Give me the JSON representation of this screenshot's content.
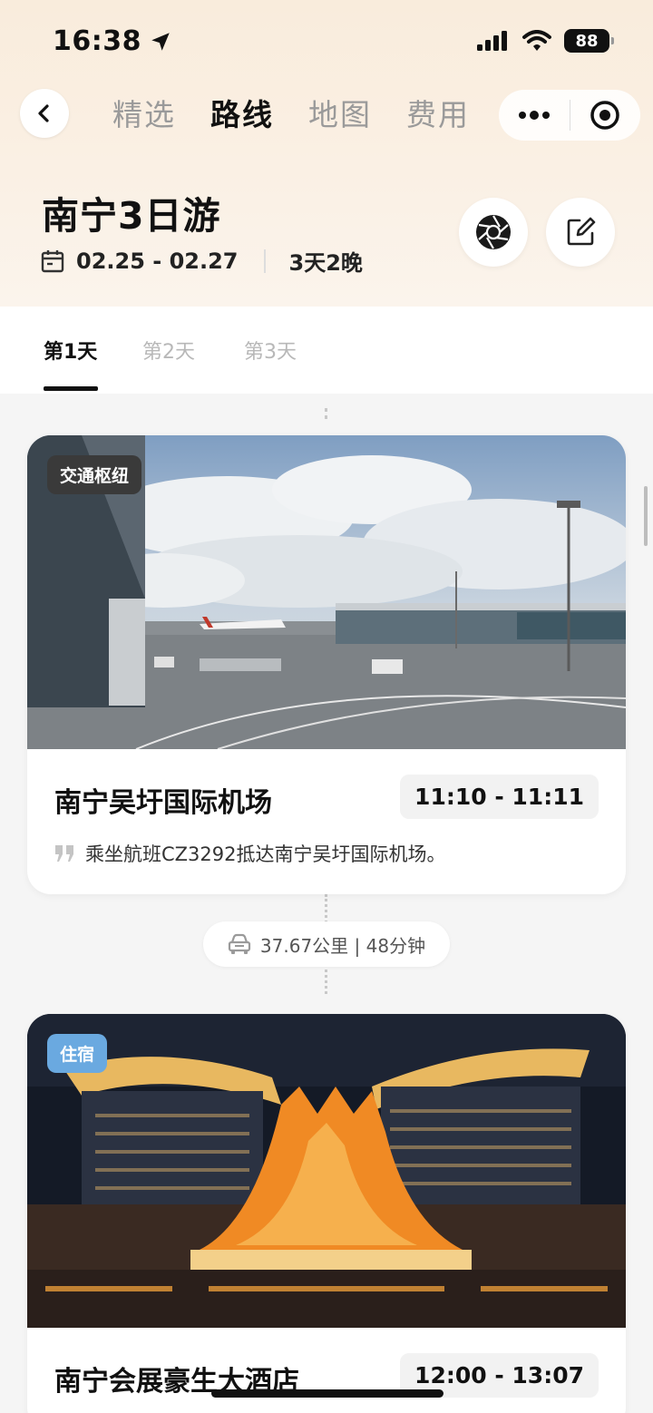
{
  "status_bar": {
    "time": "16:38",
    "battery": "88"
  },
  "nav": {
    "tabs": [
      {
        "label": "精选"
      },
      {
        "label": "路线"
      },
      {
        "label": "地图"
      },
      {
        "label": "费用"
      }
    ],
    "active_tab": "路线"
  },
  "trip": {
    "title": "南宁3日游",
    "dates": "02.25 - 02.27",
    "duration": "3天2晚"
  },
  "day_tabs": [
    {
      "label": "第1天"
    },
    {
      "label": "第2天"
    },
    {
      "label": "第3天"
    }
  ],
  "stops": [
    {
      "badge": "交通枢纽",
      "badge_color": "#3a3a3a",
      "name": "南宁吴圩国际机场",
      "time": "11:10 - 11:11",
      "desc": "乘坐航班CZ3292抵达南宁吴圩国际机场。"
    },
    {
      "badge": "住宿",
      "badge_color": "#6aa9e0",
      "name": "南宁会展豪生大酒店",
      "time": "12:00 - 13:07"
    }
  ],
  "transit": {
    "text": "37.67公里 | 48分钟"
  },
  "colors": {
    "accent": "#111111",
    "header_bg": "#f9ecdc",
    "page_bg": "#f5f5f5"
  }
}
